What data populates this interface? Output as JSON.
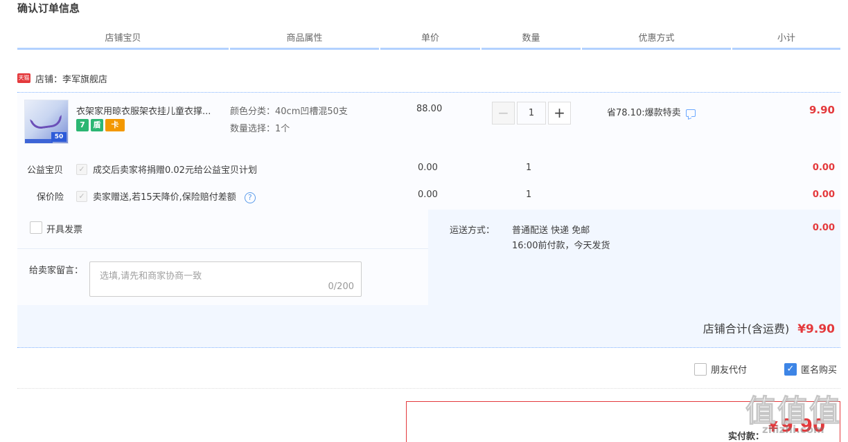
{
  "page": {
    "title": "确认订单信息"
  },
  "columns": [
    "店铺宝贝",
    "商品属性",
    "单价",
    "数量",
    "优惠方式",
    "小计"
  ],
  "shop": {
    "badge": "天猫",
    "label": "店铺：李军旗舰店"
  },
  "item": {
    "title": "衣架家用晾衣服架衣挂儿童衣撑...",
    "badges": [
      "7",
      "盾",
      "卡"
    ],
    "thumb_tag": "50",
    "attr_color": "颜色分类：40cm凹槽混50支",
    "attr_qty": "数量选择：1个",
    "price": "88.00",
    "quantity": "1",
    "minus": "−",
    "plus": "+",
    "promo": "省78.10:爆款特卖",
    "subtotal": "9.90"
  },
  "services": [
    {
      "label": "公益宝贝",
      "text": "成交后卖家将捐赠0.02元给公益宝贝计划",
      "price": "0.00",
      "qty": "1",
      "subtotal": "0.00"
    },
    {
      "label": "保价险",
      "text": "卖家赠送,若15天降价,保险赔付差额",
      "price": "0.00",
      "qty": "1",
      "subtotal": "0.00"
    }
  ],
  "invoice": {
    "label": "开具发票"
  },
  "memo": {
    "label": "给卖家留言：",
    "placeholder": "选填,请先和商家协商一致",
    "count": "0/200"
  },
  "shipping": {
    "label": "运送方式：",
    "line1": "普通配送 快递 免邮",
    "line2": "16:00前付款，今天发货",
    "fee": "0.00"
  },
  "shop_total": {
    "label": "店铺合计(含运费)",
    "amount": "¥9.90"
  },
  "options": {
    "friend_pay": "朋友代付",
    "anonymous": "匿名购买"
  },
  "payment": {
    "label": "实付款：",
    "currency": "¥",
    "amount": "9.90"
  },
  "watermark": {
    "main": "值值值",
    "sub": "zhizhi.com"
  },
  "colors": {
    "price_red": "#e4393c",
    "header_line": "#b2d1ff",
    "accent_blue": "#3d85e6"
  }
}
